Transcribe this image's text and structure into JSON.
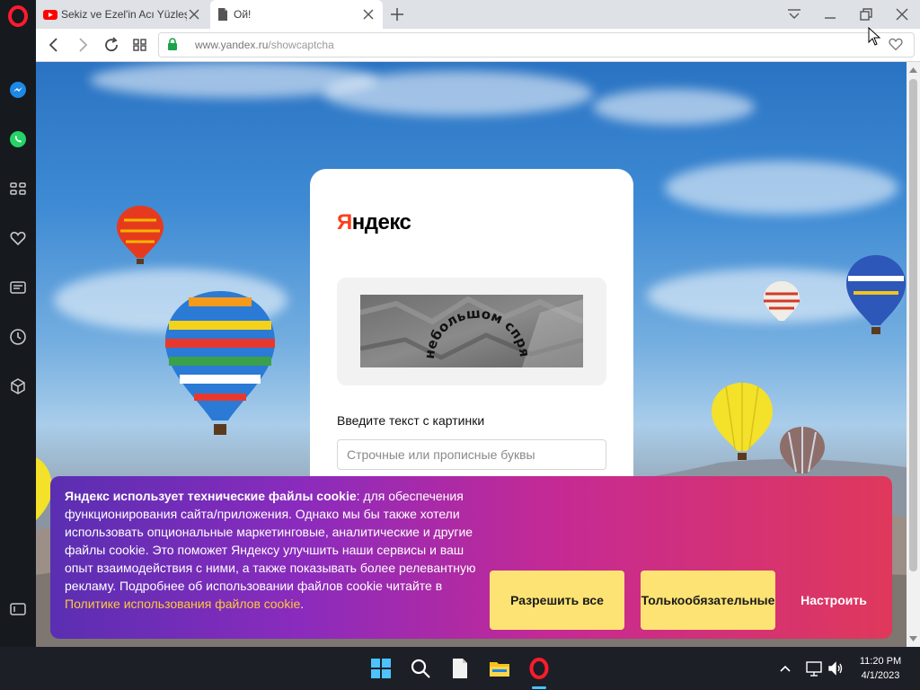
{
  "browser": {
    "tabs": [
      {
        "title": "Sekiz ve Ezel'in Acı Yüzleşm",
        "favicon": "youtube-icon",
        "active": false
      },
      {
        "title": "Ой!",
        "favicon": "document-icon",
        "active": true
      }
    ],
    "address": {
      "domain": "www.yandex.ru",
      "path": "/showcaptcha"
    }
  },
  "captcha": {
    "brand_first_letter": "Я",
    "brand_rest": "ндекс",
    "image_text": "небольшом спрятаны",
    "label": "Введите текст с картинки",
    "input_placeholder": "Строчные или прописные буквы",
    "input_value": ""
  },
  "cookie": {
    "bold_lead": "Яндекс использует технические файлы cookie",
    "body": ": для обеспечения функционирования сайта/приложения. Однако мы бы также хотели использовать опциональные маркетинговые, аналитические и другие файлы cookie. Это поможет Яндексу улучшить наши сервисы и ваш опыт взаимодействия с ними, а также показывать более релевантную рекламу. Подробнее об использовании файлов cookie читайте в ",
    "link_text": "Политике использования файлов cookie",
    "end": ".",
    "allow_all": "Разрешить все",
    "required_only_line1": "Только",
    "required_only_line2": "обязательные",
    "configure": "Настроить"
  },
  "taskbar": {
    "time": "11:20 PM",
    "date": "4/1/2023"
  },
  "colors": {
    "yandex_red": "#fc3f1d",
    "cookie_button": "#fce373",
    "cookie_link": "#ffc83d",
    "opera_red": "#ff1b2d"
  }
}
